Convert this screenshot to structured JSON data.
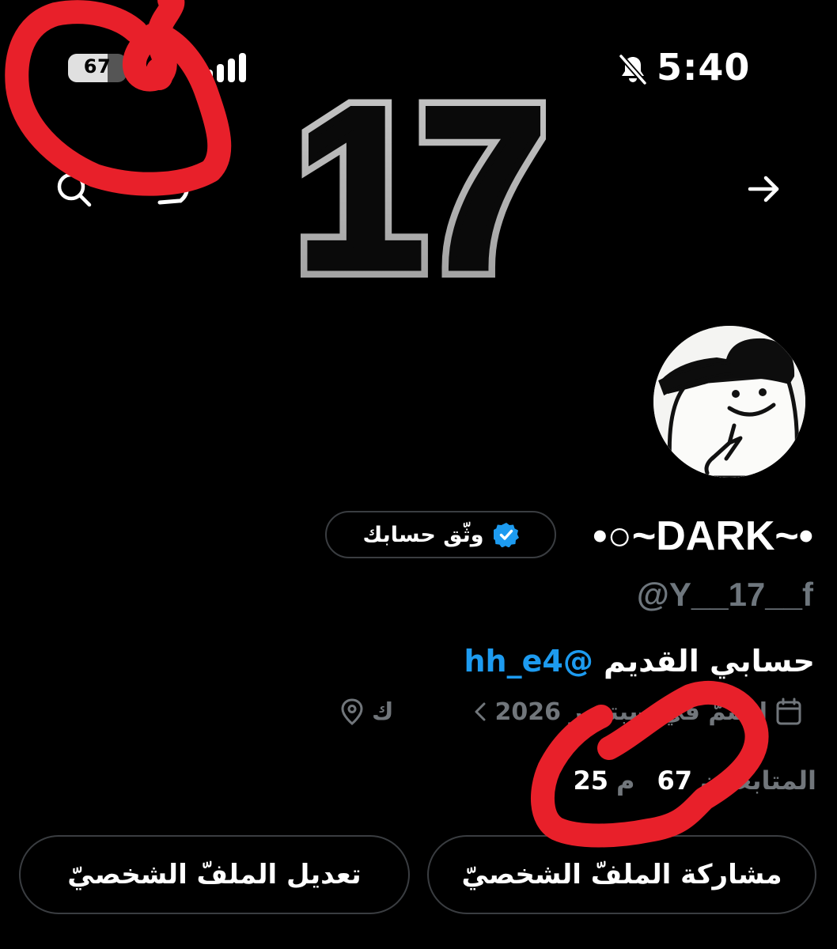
{
  "status_bar": {
    "battery_percent": "67",
    "battery_level": 0.67,
    "time": "5:40",
    "silent_icon": "bell-slash-icon",
    "signal_icon": "cellular-signal-icon"
  },
  "header": {
    "banner_text": "17",
    "search_icon": "search-icon",
    "more_icon": "more-icon",
    "forward_icon": "arrow-right-icon"
  },
  "profile": {
    "avatar_icon": "cartoon-avatar-icon",
    "display_name": "•○~DARK~•",
    "verify_label": "وثّق حسابك",
    "verified_icon": "verified-badge-icon",
    "handle": "@Y__17__f",
    "bio_text": "حسابي القديم ",
    "bio_mention": "@hh_e4",
    "location": "ك",
    "location_icon": "location-pin-icon",
    "joined": "انضمّ في سبتمبر 2026",
    "joined_icon": "calendar-icon",
    "following_count": "25",
    "following_label": "م",
    "followers_count": "67",
    "followers_label": "المتابعون"
  },
  "actions": {
    "share_label": "مشاركة الملفّ الشخصيّ",
    "edit_label": "تعديل الملفّ الشخصيّ"
  },
  "colors": {
    "background": "#000000",
    "accent": "#1d9bf0",
    "muted": "#71767b",
    "annotation": "#e8202a"
  }
}
